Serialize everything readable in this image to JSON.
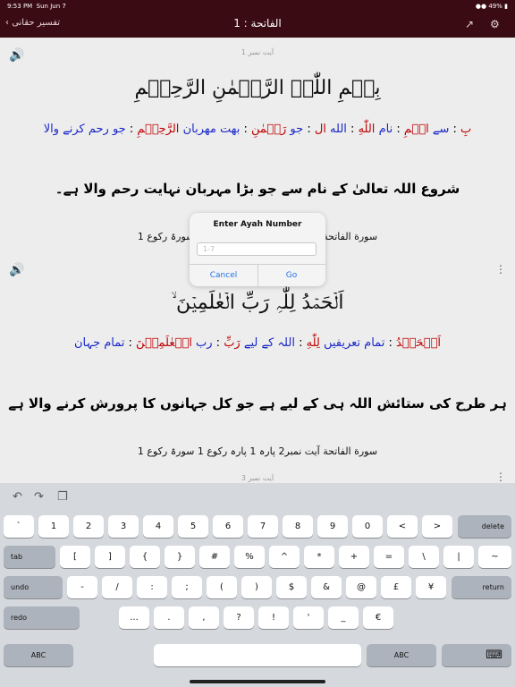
{
  "status": {
    "time": "9:53 PM",
    "date": "Sun Jun 7",
    "battery": "49%"
  },
  "nav": {
    "back_label": "تفسیر حقانی",
    "title": "الفاتحة : 1",
    "share_icon": "share-icon",
    "settings_icon": "gear-icon"
  },
  "cards": [
    {
      "ayah_no": "آیت نمبر 1",
      "arabic": "بِسۡمِ اللّٰہِ الرَّحۡمٰنِ الرَّحِیۡمِ",
      "words": [
        {
          "ar": "بِ",
          "ur": "سے"
        },
        {
          "ar": "اسۡمِ",
          "ur": "نام"
        },
        {
          "ar": "اللّٰهِ",
          "ur": "الله"
        },
        {
          "ar": "ال",
          "ur": "جو"
        },
        {
          "ar": "رَحۡمٰنِ",
          "ur": "بهت مهربان"
        },
        {
          "ar": "الرَّحِيۡمِ",
          "ur": "جو رحم کرنے والا"
        }
      ],
      "urdu": "شروع اللہ تعالیٰ کے نام سے جو بڑا مہربان نہایت رحم والا ہے۔",
      "reference": "سورة الفاتحة آیت نمبر1 پارہ 1 پارہ رکوع 1 سورۃ رکوع 1"
    },
    {
      "ayah_no": "آیت نمبر 2",
      "arabic": "اَلۡحَمۡدُ لِلّٰہِ رَبِّ الۡعٰلَمِیۡنَ ۙ",
      "words": [
        {
          "ar": "اَلۡحَمۡدُ",
          "ur": "تمام تعریفیں"
        },
        {
          "ar": "لِلّٰهِ",
          "ur": "اللہ کے لیے"
        },
        {
          "ar": "رَبِّ",
          "ur": "رب"
        },
        {
          "ar": "الۡعٰلَمِيۡنَ",
          "ur": "تمام جہان"
        }
      ],
      "urdu": "ہر طرح کی ستائش اللہ ہی کے لیے ہے جو کل جہانوں کا پرورش کرنے والا ہے",
      "reference": "سورة الفاتحة آیت نمبر2   پارہ 1 پارہ رکوع 1 سورۃ رکوع 1"
    },
    {
      "ayah_no": "آیت نمبر 3"
    }
  ],
  "dialog": {
    "title": "Enter Ayah Number",
    "placeholder": "1-7",
    "cancel": "Cancel",
    "go": "Go"
  },
  "keyboard": {
    "toolbar": {
      "undo_icon": "undo-icon",
      "redo_icon": "redo-icon",
      "paste_icon": "paste-icon"
    },
    "row1": [
      "`",
      "1",
      "2",
      "3",
      "4",
      "5",
      "6",
      "7",
      "8",
      "9",
      "0",
      "<",
      ">"
    ],
    "delete": "delete",
    "tab": "tab",
    "row2": [
      "[",
      "]",
      "{",
      "}",
      "#",
      "%",
      "^",
      "*",
      "+",
      "=",
      "\\",
      "|",
      "~"
    ],
    "undo": "undo",
    "row3": [
      "-",
      "/",
      ":",
      ";",
      "(",
      ")",
      "$",
      "&",
      "@",
      "£",
      "¥"
    ],
    "return": "return",
    "redo": "redo",
    "row4": [
      "...",
      ".",
      ",",
      "?",
      "!",
      "'",
      "_",
      "€"
    ],
    "abc": "ABC",
    "abc2": "ABC",
    "kb_icon": "keyboard-dismiss-icon"
  }
}
